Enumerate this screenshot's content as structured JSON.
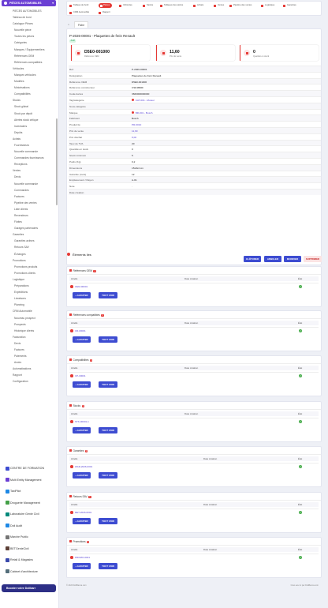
{
  "sidebar": {
    "module": "PIÈCES AUTOMOBILES",
    "items": [
      {
        "label": "PIÈCES AUTOMOBILES",
        "lvl": 1
      },
      {
        "label": "Tableau de bord",
        "lvl": 1
      },
      {
        "label": "Catalogue Pièces",
        "lvl": 1
      },
      {
        "label": "Nouvelle pièce",
        "lvl": 2
      },
      {
        "label": "Toutes les pièces",
        "lvl": 2
      },
      {
        "label": "Catégories",
        "lvl": 2
      },
      {
        "label": "Marques / Équipementiers",
        "lvl": 2
      },
      {
        "label": "Références OEM",
        "lvl": 2
      },
      {
        "label": "Références compatibles",
        "lvl": 2
      },
      {
        "label": "Véhicules",
        "lvl": 1
      },
      {
        "label": "Marques véhicules",
        "lvl": 2
      },
      {
        "label": "Modèles",
        "lvl": 2
      },
      {
        "label": "Motorisations",
        "lvl": 2
      },
      {
        "label": "Compatibilités",
        "lvl": 2
      },
      {
        "label": "Stocks",
        "lvl": 1
      },
      {
        "label": "Stock global",
        "lvl": 2
      },
      {
        "label": "Stock par dépôt",
        "lvl": 2
      },
      {
        "label": "Alertes stock critique",
        "lvl": 2
      },
      {
        "label": "Inventaires",
        "lvl": 2
      },
      {
        "label": "Dépôts",
        "lvl": 2
      },
      {
        "label": "Achats",
        "lvl": 1
      },
      {
        "label": "Fournisseurs",
        "lvl": 2
      },
      {
        "label": "Nouvelle commande",
        "lvl": 2
      },
      {
        "label": "Commandes fournisseurs",
        "lvl": 2
      },
      {
        "label": "Réceptions",
        "lvl": 2
      },
      {
        "label": "Ventes",
        "lvl": 1
      },
      {
        "label": "Devis",
        "lvl": 2
      },
      {
        "label": "Nouvelle commande",
        "lvl": 2
      },
      {
        "label": "Commandes",
        "lvl": 2
      },
      {
        "label": "Factures",
        "lvl": 2
      },
      {
        "label": "Pipeline des ventes",
        "lvl": 2
      },
      {
        "label": "Liste clients",
        "lvl": 2
      },
      {
        "label": "Revendeurs",
        "lvl": 2
      },
      {
        "label": "Flottes",
        "lvl": 2
      },
      {
        "label": "Garages partenaires",
        "lvl": 2
      },
      {
        "label": "Garanties",
        "lvl": 1
      },
      {
        "label": "Garanties actives",
        "lvl": 2
      },
      {
        "label": "Retours SAV",
        "lvl": 2
      },
      {
        "label": "Échanges",
        "lvl": 2
      },
      {
        "label": "Promotions",
        "lvl": 1
      },
      {
        "label": "Promotions produits",
        "lvl": 2
      },
      {
        "label": "Promotions clients",
        "lvl": 2
      },
      {
        "label": "Logistique",
        "lvl": 1
      },
      {
        "label": "Préparations",
        "lvl": 2
      },
      {
        "label": "Expéditions",
        "lvl": 2
      },
      {
        "label": "Livraisons",
        "lvl": 2
      },
      {
        "label": "Planning",
        "lvl": 2
      },
      {
        "label": "CRM Automobile",
        "lvl": 1
      },
      {
        "label": "Nouveau prospect",
        "lvl": 2
      },
      {
        "label": "Prospects",
        "lvl": 2
      },
      {
        "label": "Historique clients",
        "lvl": 2
      },
      {
        "label": "Facturation",
        "lvl": 1
      },
      {
        "label": "Devis",
        "lvl": 2
      },
      {
        "label": "Factures",
        "lvl": 2
      },
      {
        "label": "Paiements",
        "lvl": 2
      },
      {
        "label": "Avoirs",
        "lvl": 2
      },
      {
        "label": "Automatisations",
        "lvl": 1
      },
      {
        "label": "Rapport",
        "lvl": 1
      },
      {
        "label": "Configuration",
        "lvl": 1
      }
    ],
    "apps": [
      {
        "label": "CENTRE DE FORMATION",
        "color": "#3d4cd1"
      },
      {
        "label": "Multi Entity Management",
        "color": "#6b3fd4"
      },
      {
        "label": "TaxiPilot",
        "color": "#1e88e5"
      },
      {
        "label": "Droguerie Management",
        "color": "#43a047"
      },
      {
        "label": "Laboratoire Genie Civil",
        "color": "#00897b"
      },
      {
        "label": "Doli Audit",
        "color": "#1e88e5"
      },
      {
        "label": "Marche Public",
        "color": "#757575"
      },
      {
        "label": "BETGenieCivil",
        "color": "#5d4037"
      },
      {
        "label": "Retail & Magasins",
        "color": "#3949ab"
      },
      {
        "label": "Cabinet d'architecture",
        "color": "#546e7a"
      }
    ],
    "cta": "Booster votre Dolibarr"
  },
  "topnav": [
    {
      "label": "Tableau de bord",
      "active": false,
      "color": "#e53935"
    },
    {
      "label": "Pièces",
      "active": true,
      "color": "#e53935"
    },
    {
      "label": "Véhicules",
      "active": false,
      "color": "#e53935"
    },
    {
      "label": "Stocks",
      "active": false,
      "color": "#e53935"
    },
    {
      "label": "Tableaux des stocks",
      "active": false,
      "color": "#e53935"
    },
    {
      "label": "Achats",
      "active": false,
      "color": "#e53935"
    },
    {
      "label": "Ventes",
      "active": false,
      "color": "#e53935"
    },
    {
      "label": "Pipeline des ventes",
      "active": false,
      "color": "#e53935"
    },
    {
      "label": "Logistique",
      "active": false,
      "color": "#e53935"
    },
    {
      "label": "Garanties",
      "active": false,
      "color": "#e53935"
    },
    {
      "label": "CRM Automobile",
      "active": false,
      "color": "#e53935"
    },
    {
      "label": "Rapport",
      "active": false,
      "color": "#e53935"
    }
  ],
  "tabs": {
    "home_icon": "⌂",
    "fiche": "Fiche"
  },
  "piece": {
    "title": "P-2026-00001 - Plaquettes de frein Renault",
    "status": "Actif",
    "stats": [
      {
        "value": "D5E0-001000",
        "label": "Référence OEM"
      },
      {
        "value": "11,60",
        "label": "Prix de vente"
      },
      {
        "value": "0",
        "label": "Quantité en stock"
      }
    ],
    "fields": [
      {
        "k": "Ref.",
        "v": "P-2026-00001",
        "type": "plain"
      },
      {
        "k": "Désignation",
        "v": "Plaquettes de frein Renault",
        "type": "plain"
      },
      {
        "k": "Référence OEM",
        "v": "D5E0-001000",
        "type": "plain"
      },
      {
        "k": "Référence constructeur",
        "v": "CSF4866F",
        "type": "plain"
      },
      {
        "k": "Code-barres",
        "v": "3660000000000",
        "type": "plain"
      },
      {
        "k": "Tag/catégorie",
        "v": "CAT-001 - Moteur",
        "type": "link"
      },
      {
        "k": "Sous-catégorie",
        "v": "",
        "type": "plain"
      },
      {
        "k": "Marque",
        "v": "BR-001 - Bosch",
        "type": "link"
      },
      {
        "k": "Fabricant",
        "v": "Bosch",
        "type": "plain"
      },
      {
        "k": "Produit lié",
        "v": "PR-0010",
        "type": "link"
      },
      {
        "k": "Prix de vente",
        "v": "11,60",
        "type": "link"
      },
      {
        "k": "Prix d'achat",
        "v": "8,00",
        "type": "link"
      },
      {
        "k": "Taux de TVA",
        "v": "20",
        "type": "plain"
      },
      {
        "k": "Quantité en stock",
        "v": "0",
        "type": "plain"
      },
      {
        "k": "Stock minimum",
        "v": "5",
        "type": "plain"
      },
      {
        "k": "Poids (Kg)",
        "v": "0,2",
        "type": "plain"
      },
      {
        "k": "Dimensions",
        "v": "15x8x4 cm",
        "type": "plain"
      },
      {
        "k": "Garantie (mois)",
        "v": "12",
        "type": "plain"
      },
      {
        "k": "Emplacement / Rayon",
        "v": "A-01",
        "type": "plain"
      },
      {
        "k": "Note",
        "v": "-",
        "type": "ital"
      },
      {
        "k": "Date création",
        "v": "",
        "type": "plain"
      }
    ],
    "actions": [
      {
        "label": "CLÔTURER",
        "bg": "#3d4cd1",
        "fg": "#ffffff"
      },
      {
        "label": "ANNULER",
        "bg": "#3d4cd1",
        "fg": "#ffffff"
      },
      {
        "label": "MODIFIER",
        "bg": "#3d4cd1",
        "fg": "#ffffff"
      },
      {
        "label": "SUPPRIMER",
        "bg": "#fbe3e3",
        "fg": "#c62828"
      }
    ]
  },
  "related": {
    "title": "Éléments liés",
    "cols": {
      "libelle": "Libellé",
      "date": "Date création",
      "etat": "État"
    },
    "add": "+ AJOUTER",
    "all": "TOUT VOIR",
    "ok": "✓",
    "sections": [
      {
        "title": "Références OEM",
        "count": "1",
        "item": "OEM-00001"
      },
      {
        "title": "Références compatibles",
        "count": "1",
        "item": "CR-00001"
      },
      {
        "title": "Compatibilités",
        "count": "1",
        "item": "CP-00001"
      },
      {
        "title": "Stocks",
        "count": "1",
        "item": "STK-00001-1"
      },
      {
        "title": "Garanties",
        "count": "1",
        "item": "WAR-2026-0001"
      },
      {
        "title": "Retours SAV",
        "count": "1",
        "item": "RET-2026-0001"
      },
      {
        "title": "Promotions",
        "count": "1",
        "item": "PROMO-0001"
      }
    ]
  },
  "footer": {
    "left": "© 2026 DoliBanca.com",
    "right": "Créé avec ♥ par DoliBanca.com"
  }
}
